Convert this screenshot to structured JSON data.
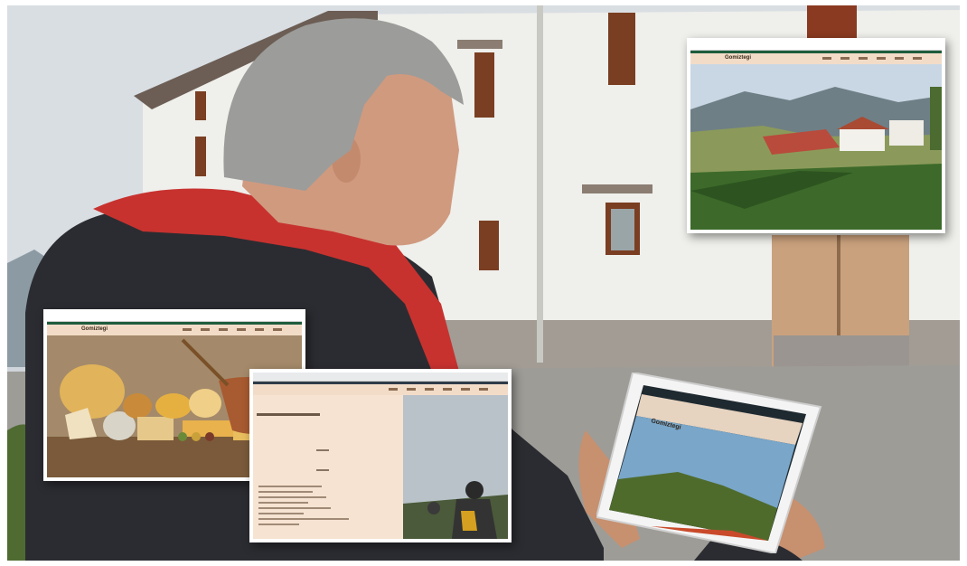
{
  "screenshots": [
    {
      "id": "farmhouse",
      "brand": "Gomiztegi",
      "nav_items": 6
    },
    {
      "id": "cheese",
      "brand": "Gomiztegi",
      "nav_items": 6
    },
    {
      "id": "text-page",
      "brand": "",
      "nav_items": 6
    }
  ],
  "tablet": {
    "brand": "Gomiztegi"
  }
}
